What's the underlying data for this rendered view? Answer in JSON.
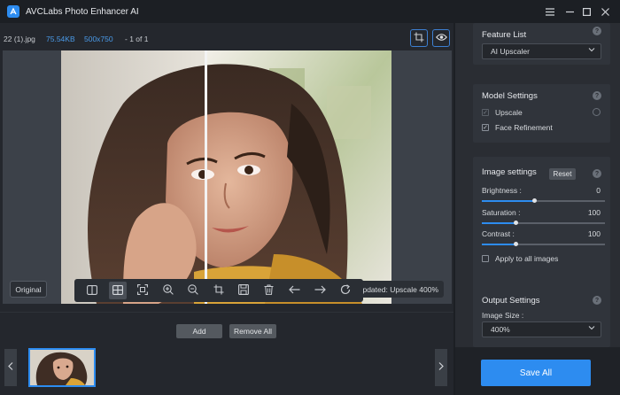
{
  "window": {
    "title": "AVCLabs Photo Enhancer AI",
    "controls": [
      "hamburger-icon",
      "minimize-icon",
      "maximize-icon",
      "close-icon"
    ]
  },
  "file_info": {
    "name": "22 (1).jpg",
    "size": "75.54KB",
    "dimensions": "500x750",
    "page": "- 1 of 1"
  },
  "preview": {
    "original_label": "Original",
    "updated_label": "Updated: Upscale 400%",
    "toolbar_icons": [
      "split-view-icon",
      "compare-view-icon",
      "fit-screen-icon",
      "zoom-in-icon",
      "zoom-out-icon",
      "crop-icon",
      "save-icon",
      "delete-icon",
      "arrow-left-icon",
      "arrow-right-icon",
      "rotate-icon"
    ]
  },
  "actions": {
    "add_label": "Add",
    "remove_all_label": "Remove All"
  },
  "right_panel": {
    "feature_list": {
      "title": "Feature List",
      "selected": "AI Upscaler"
    },
    "model_settings": {
      "title": "Model Settings",
      "upscale_label": "Upscale",
      "upscale_checked": true,
      "face_refinement_label": "Face Refinement",
      "face_refinement_checked": true
    },
    "image_settings": {
      "title": "Image settings",
      "reset_label": "Reset",
      "brightness_label": "Brightness :",
      "brightness_value": "0",
      "saturation_label": "Saturation :",
      "saturation_value": "100",
      "contrast_label": "Contrast :",
      "contrast_value": "100",
      "apply_all_label": "Apply to all images",
      "apply_all_checked": false
    },
    "output_settings": {
      "title": "Output Settings",
      "image_size_label": "Image Size :",
      "image_size_selected": "400%"
    },
    "save_all_label": "Save All"
  },
  "colors": {
    "accent": "#2d8cf0",
    "background": "#24272d",
    "panel": "#2a2d33"
  }
}
